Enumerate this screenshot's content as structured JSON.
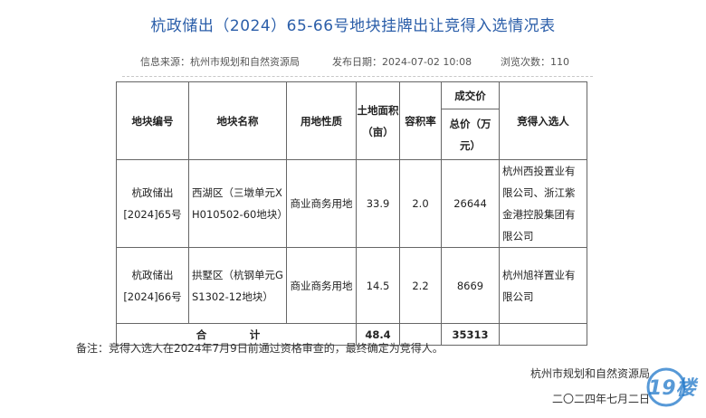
{
  "title": "杭政储出（2024）65-66号地块挂牌出让竞得入选情况表",
  "meta": {
    "source": "信息来源：杭州市规划和自然资源局",
    "published": "发布日期：2024-07-02 10:08",
    "views": "浏览次数：110"
  },
  "table": {
    "headers": {
      "plot_no": "地块编号",
      "plot_name": "地块名称",
      "land_use": "用地性质",
      "area": "土地面积（亩）",
      "far": "容积率",
      "price_group": "成交价",
      "total_price": "总价（万元）",
      "winner": "竞得入选人"
    },
    "rows": [
      {
        "plot_no": "杭政储出[2024]65号",
        "plot_name": "西湖区（三墩单元XH010502-60地块）",
        "land_use": "商业商务用地",
        "area": "33.9",
        "far": "2.0",
        "total_price": "26644",
        "winner": "杭州西投置业有限公司、浙江紫金港控股集团有限公司"
      },
      {
        "plot_no": "杭政储出[2024]66号",
        "plot_name": "拱墅区（杭钢单元GS1302-12地块）",
        "land_use": "商业商务用地",
        "area": "14.5",
        "far": "2.2",
        "total_price": "8669",
        "winner": "杭州旭祥置业有限公司"
      }
    ],
    "total": {
      "label": "合　计",
      "area": "48.4",
      "total_price": "35313"
    }
  },
  "note": "备注：竞得入选人在2024年7月9日前通过资格审查的，最终确定为竞得人。",
  "signature": {
    "org": "杭州市规划和自然资源局",
    "date": "二〇二四年七月二日"
  },
  "watermark": {
    "text": "19楼",
    "color": "#1f77c9"
  }
}
